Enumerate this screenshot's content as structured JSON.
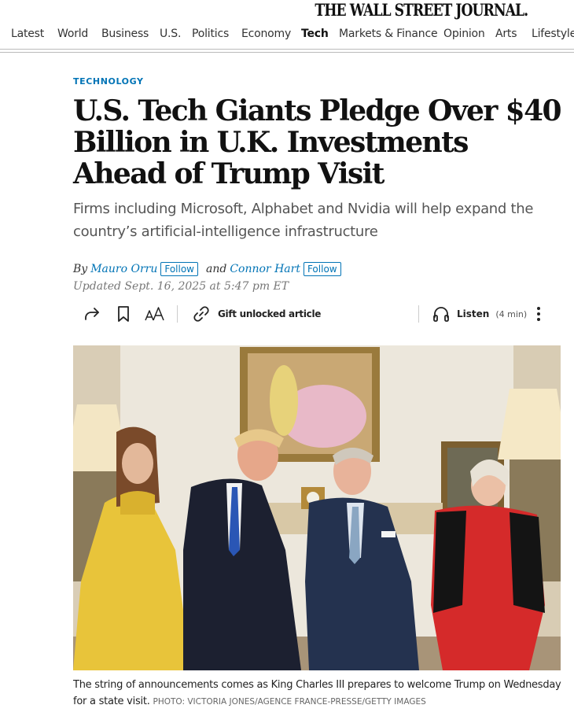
{
  "masthead": {
    "title": "THE WALL STREET JOURNAL."
  },
  "nav": {
    "items": [
      "Latest",
      "World",
      "Business",
      "U.S.",
      "Politics",
      "Economy",
      "Tech",
      "Markets & Finance",
      "Opinion",
      "Arts",
      "Lifestyle"
    ],
    "active": "Tech"
  },
  "article": {
    "section": "TECHNOLOGY",
    "headline": "U.S. Tech Giants Pledge Over $40 Billion in U.K. Investments Ahead of Trump Visit",
    "dek": "Firms including Microsoft, Alphabet and Nvidia will help expand the country’s artificial-intelligence infrastructure",
    "byline": {
      "by": "By",
      "and": "and",
      "authors": [
        "Mauro Orru",
        "Connor Hart"
      ],
      "follow_label": "Follow"
    },
    "timestamp": "Updated Sept. 16, 2025 at 5:47 pm ET"
  },
  "toolbar": {
    "icons": [
      "share-icon",
      "bookmark-icon",
      "text-size-icon",
      "gift-link-icon",
      "headphones-icon",
      "more-icon"
    ],
    "gift_label": "Gift unlocked article",
    "listen_label": "Listen",
    "listen_duration": "(4 min)"
  },
  "photo": {
    "caption": "The string of announcements comes as King Charles III prepares to welcome Trump on Wednesday for a state visit.",
    "credit": "PHOTO: VICTORIA JONES/AGENCE FRANCE-PRESSE/GETTY IMAGES"
  },
  "colors": {
    "accent": "#0274b6",
    "text": "#111111",
    "muted": "#555555"
  }
}
